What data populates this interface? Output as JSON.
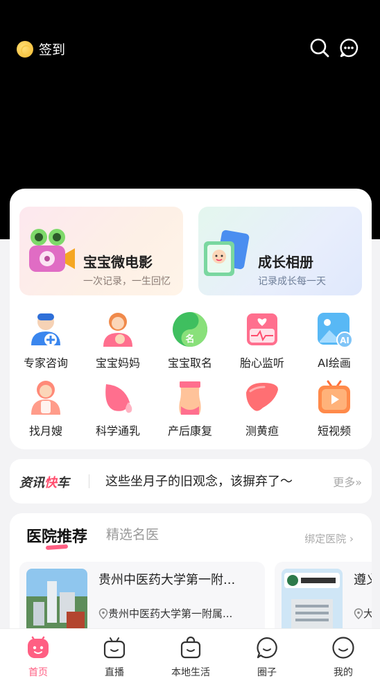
{
  "header": {
    "checkin_label": "签到"
  },
  "features": [
    {
      "title": "宝宝微电影",
      "subtitle": "一次记录，一生回忆"
    },
    {
      "title": "成长相册",
      "subtitle": "记录成长每一天"
    }
  ],
  "grid": [
    {
      "label": "专家咨询"
    },
    {
      "label": "宝宝妈妈"
    },
    {
      "label": "宝宝取名"
    },
    {
      "label": "胎心监听"
    },
    {
      "label": "AI绘画"
    },
    {
      "label": "找月嫂"
    },
    {
      "label": "科学通乳"
    },
    {
      "label": "产后康复"
    },
    {
      "label": "测黄疸"
    },
    {
      "label": "短视频"
    }
  ],
  "news": {
    "logo_a": "资讯",
    "logo_b": "快",
    "logo_c": "车",
    "headline": "这些坐月子的旧观念，该摒弃了～",
    "more": "更多»"
  },
  "hospitals": {
    "tab_active": "医院推荐",
    "tab_other": "精选名医",
    "bind_link": "绑定医院 ›",
    "items": [
      {
        "name": "贵州中医药大学第一附...",
        "address": "贵州中医药大学第一附属..."
      },
      {
        "name": "遵义",
        "address": "大"
      }
    ]
  },
  "tabbar": [
    {
      "label": "首页"
    },
    {
      "label": "直播"
    },
    {
      "label": "本地生活"
    },
    {
      "label": "圈子"
    },
    {
      "label": "我的"
    }
  ],
  "colors": {
    "accent": "#ff5f83",
    "hero_bg": "#000000"
  }
}
